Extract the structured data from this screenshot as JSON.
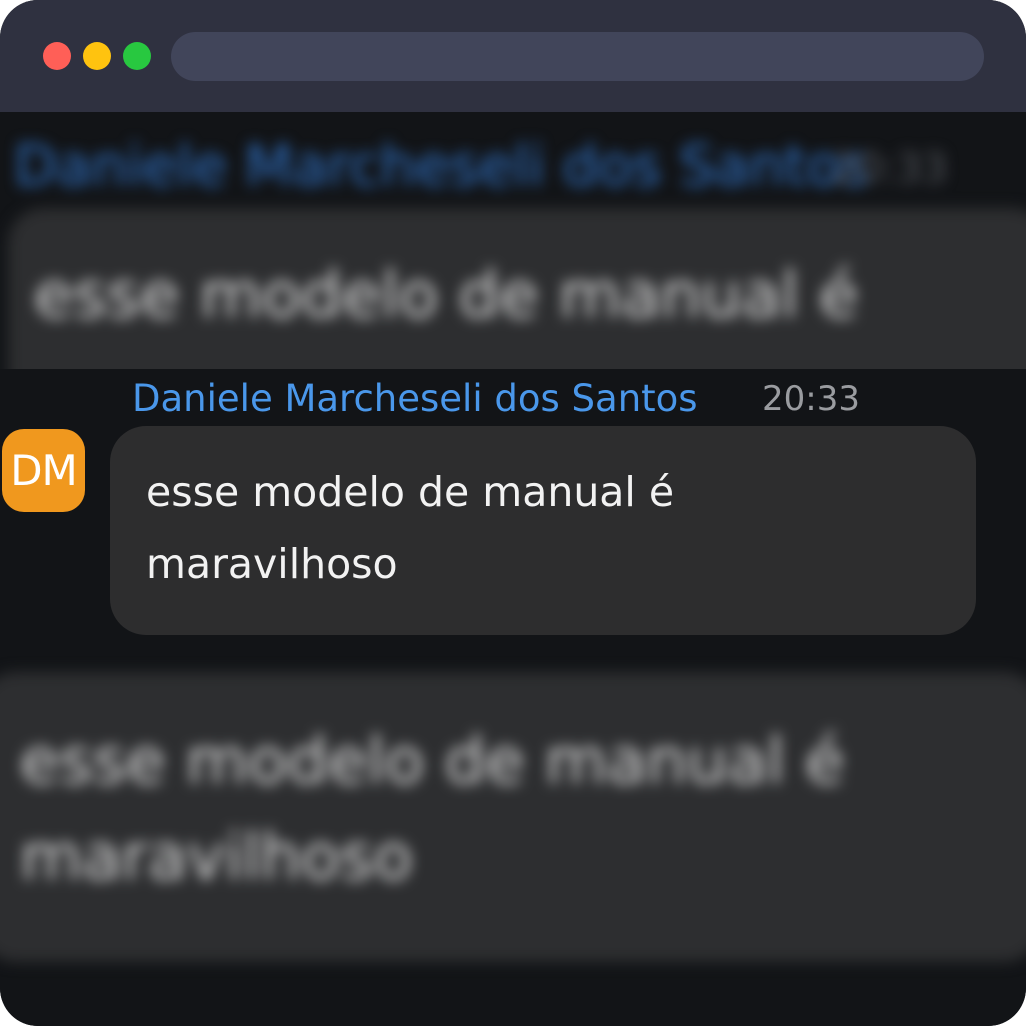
{
  "window": {
    "traffic_lights": [
      "close",
      "minimize",
      "maximize"
    ],
    "colors": {
      "titlebar": "#2f3140",
      "close": "#ff5f57",
      "minimize": "#ffc30f",
      "maximize": "#28c840",
      "content_bg": "#121417"
    }
  },
  "message": {
    "sender": "Daniele Marcheseli dos Santos",
    "time": "20:33",
    "avatar_initials": "DM",
    "avatar_color": "#f0981e",
    "sender_color": "#4a97ea",
    "text": "esse modelo de manual é maravilhoso",
    "bubble_color": "#2d2d2e"
  },
  "background_blur": {
    "top_sender": "Daniele Marcheseli dos Santos",
    "top_time": "20:33",
    "top_text": "esse modelo de manual é",
    "bottom_text_line1": "esse modelo de manual é",
    "bottom_text_line2": "maravilhoso"
  }
}
